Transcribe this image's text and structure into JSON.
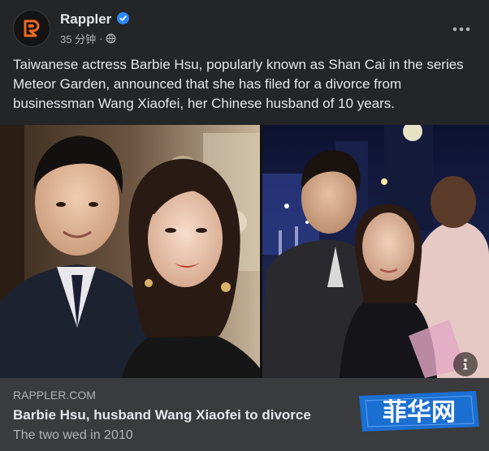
{
  "post": {
    "page_name": "Rappler",
    "timestamp": "35 分钟",
    "separator": "·",
    "body_text": "Taiwanese actress Barbie Hsu, popularly known as Shan Cai in the series Meteor Garden, announced that she has filed for a divorce from businessman Wang Xiaofei, her Chinese husband of 10 years."
  },
  "icons": {
    "avatar": "rappler-logo",
    "verified": "verified-badge-icon",
    "privacy": "globe-icon",
    "more": "more-options-icon",
    "info": "info-icon"
  },
  "link_preview": {
    "domain": "RAPPLER.COM",
    "title": "Barbie Hsu, husband Wang Xiaofei to divorce",
    "subtitle": "The two wed in 2010"
  },
  "watermark": {
    "text": "菲华网"
  },
  "colors": {
    "background": "#242526",
    "link_box": "#3a3b3c",
    "verified_blue": "#2d88ff",
    "rappler_orange": "#f26722",
    "watermark_blue": "#1a6fd1"
  }
}
